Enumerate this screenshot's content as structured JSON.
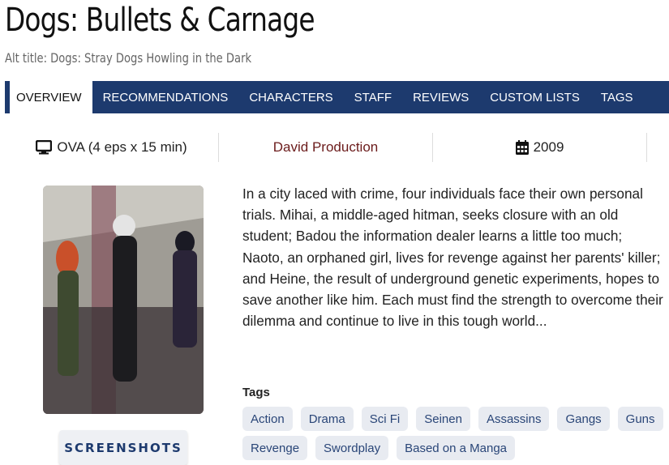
{
  "title": "Dogs: Bullets & Carnage",
  "alt_title": "Alt title: Dogs: Stray Dogs Howling in the Dark",
  "tabs": [
    {
      "label": "OVERVIEW",
      "active": true
    },
    {
      "label": "RECOMMENDATIONS"
    },
    {
      "label": "CHARACTERS"
    },
    {
      "label": "STAFF"
    },
    {
      "label": "REVIEWS"
    },
    {
      "label": "CUSTOM LISTS"
    },
    {
      "label": "TAGS"
    }
  ],
  "meta": {
    "format": "OVA (4 eps x 15 min)",
    "format_icon": "monitor-icon",
    "studio": "David Production",
    "year": "2009",
    "year_icon": "calendar-icon"
  },
  "screenshots_label": "SCREENSHOTS",
  "synopsis": "In a city laced with crime, four individuals face their own personal trials. Mihai, a middle-aged hitman, seeks closure with an old student; Badou the information dealer learns a little too much; Naoto, an orphaned girl, lives for revenge against her parents' killer; and Heine, the result of underground genetic experiments, hopes to save another like him. Each must find the strength to overcome their dilemma and continue to live in this tough world...",
  "tags_heading": "Tags",
  "tags": [
    "Action",
    "Drama",
    "Sci Fi",
    "Seinen",
    "Assassins",
    "Gangs",
    "Guns",
    "Revenge",
    "Swordplay",
    "Based on a Manga"
  ],
  "colors": {
    "nav_bg": "#1d3a6e",
    "studio_text": "#6b1b1b",
    "tag_bg": "#e8ebf1",
    "tag_text": "#2a4678"
  }
}
